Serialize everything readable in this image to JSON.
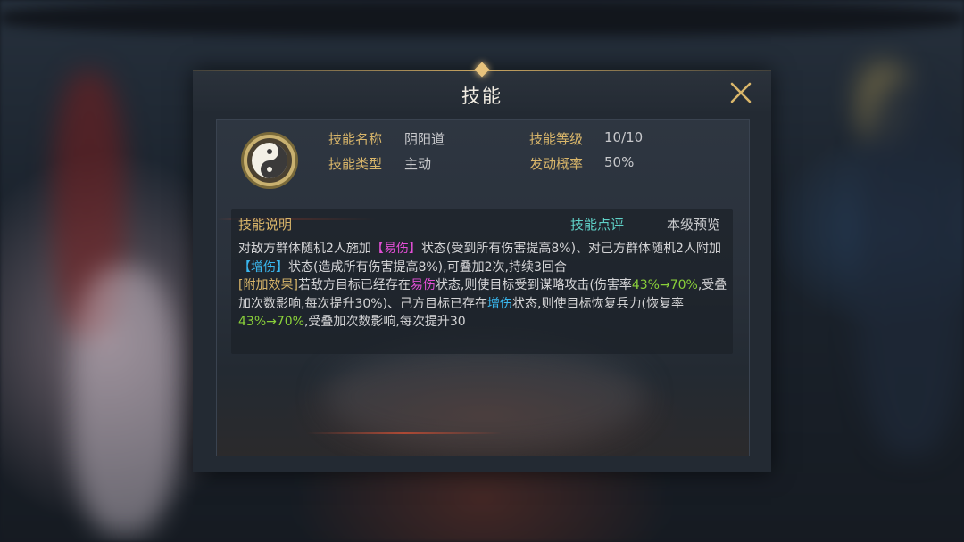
{
  "dialog": {
    "title": "技能",
    "skill": {
      "icon": "yin-yang-icon",
      "name_label": "技能名称",
      "name_value": "阴阳道",
      "type_label": "技能类型",
      "type_value": "主动",
      "level_label": "技能等级",
      "level_value": "10/10",
      "rate_label": "发动概率",
      "rate_value": "50%"
    },
    "description": {
      "title": "技能说明",
      "eval_link": "技能点评",
      "preview_link": "本级预览",
      "p1_a": "对敌方群体随机2人施加",
      "p1_tag1": "【易伤】",
      "p1_b": "状态(受到所有伤害提高8%)、对己方群体随机2人附加",
      "p1_tag2": "【增伤】",
      "p1_c": "状态(造成所有伤害提高8%),可叠加2次,持续3回合",
      "p2_tag": "[附加效果]",
      "p2_a": "若敌方目标已经存在",
      "p2_kw1": "易伤",
      "p2_b": "状态,则使目标受到谋略攻击(伤害率",
      "p2_range1": "43%→70%",
      "p2_c": ",受叠加次数影响,每次提升30%)、己方目标已存在",
      "p2_kw2": "增伤",
      "p2_d": "状态,则使目标恢复兵力(恢复率",
      "p2_range2": "43%→70%",
      "p2_e": ",受叠加次数影响,每次提升30"
    }
  },
  "colors": {
    "gold": "#d9b66a",
    "teal_link": "#5fd2c8",
    "debuff_pink": "#e34fd6",
    "buff_blue": "#3ab8f0",
    "range_green": "#8ad03a"
  }
}
